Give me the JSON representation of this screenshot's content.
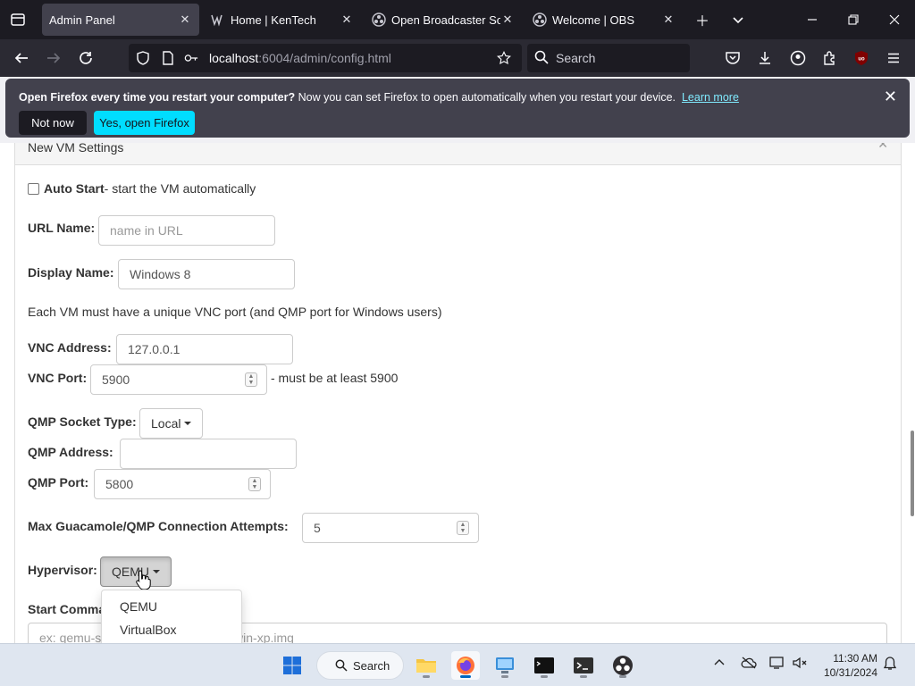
{
  "browser": {
    "tabs": [
      {
        "label": "Admin Panel",
        "active": true,
        "icon": "page-icon"
      },
      {
        "label": "Home | KenTech",
        "active": false,
        "icon": "kentech-icon"
      },
      {
        "label": "Open Broadcaster Softw",
        "active": false,
        "icon": "obs-icon"
      },
      {
        "label": "Welcome | OBS",
        "active": false,
        "icon": "obs-icon"
      }
    ],
    "url_host": "localhost",
    "url_rest": ":6004/admin/config.html",
    "search_placeholder": "Search"
  },
  "notification": {
    "bold": "Open Firefox every time you restart your computer?",
    "text": " Now you can set Firefox to open automatically when you restart your device.",
    "link": "Learn more",
    "not_now": "Not now",
    "yes": "Yes, open Firefox"
  },
  "form": {
    "panel_title": "New VM Settings",
    "auto_start_label": "Auto Start",
    "auto_start_desc": " - start the VM automatically",
    "url_name_label": "URL Name:",
    "url_name_placeholder": "name in URL",
    "display_name_label": "Display Name:",
    "display_name_value": "Windows 8",
    "vnc_note": "Each VM must have a unique VNC port (and QMP port for Windows users)",
    "vnc_address_label": "VNC Address:",
    "vnc_address_value": "127.0.0.1",
    "vnc_port_label": "VNC Port:",
    "vnc_port_value": "5900",
    "vnc_port_hint": "- must be at least 5900",
    "qmp_socket_label": "QMP Socket Type:",
    "qmp_socket_value": "Local",
    "qmp_address_label": "QMP Address:",
    "qmp_address_value": "",
    "qmp_port_label": "QMP Port:",
    "qmp_port_value": "5800",
    "max_attempts_label": "Max Guacamole/QMP Connection Attempts:",
    "max_attempts_value": "5",
    "hypervisor_label": "Hypervisor:",
    "hypervisor_value": "QEMU",
    "hypervisor_options": [
      "QEMU",
      "VirtualBox"
    ],
    "start_command_label": "Start Comma",
    "start_command_placeholder_a": "ex: qemu-s",
    "start_command_placeholder_b": "e/user/win-xp.img"
  },
  "taskbar": {
    "search_label": "Search",
    "time": "11:30 AM",
    "date": "10/31/2024"
  }
}
